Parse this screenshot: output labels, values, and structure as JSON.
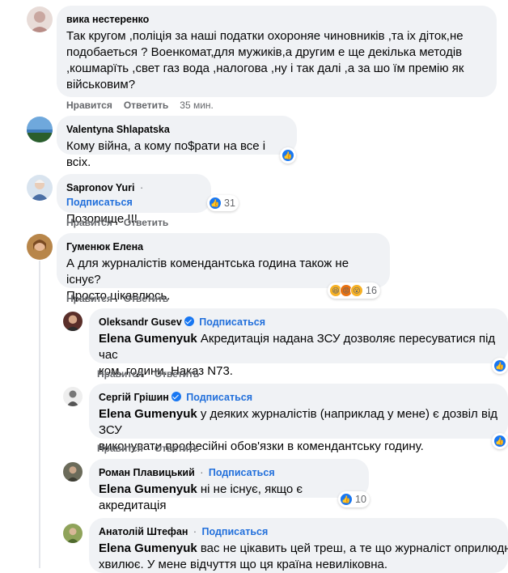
{
  "actions": {
    "like": "Нравится",
    "reply": "Ответить"
  },
  "comments": [
    {
      "name": "вика нестеренко",
      "lines": [
        "Так кругом ,поліція за наші податки охороняе чиновників ,та іх діток,не",
        "подобаеться ? Военкомат,для мужиків,а другим е ще декілька методів",
        ",кошмарїть ,свет газ вода ,налогова ,ну і так далі ,а за шо їм премію як",
        "військовим?"
      ],
      "time": "35 мин."
    },
    {
      "name": "Valentyna Shlapatska",
      "lines": [
        "Кому війна, а кому по$рати на все і всіх."
      ]
    },
    {
      "name": "Sapronov Yuri",
      "dot": "·",
      "subscribe": "Подписаться",
      "lines": [
        "Позорище !!!"
      ],
      "reaction_count": "31"
    },
    {
      "name": "Гуменюк Елена",
      "lines": [
        "А для журналістів комендантська година також не існує?",
        "Просто цікавлюсь."
      ],
      "reaction_count": "16"
    }
  ],
  "replies": [
    {
      "name": "Oleksandr Gusev",
      "subscribe": "Подписаться",
      "mention": "Elena Gumenyuk",
      "first": " Акредитація надана ЗСУ дозволяє пересуватися під час",
      "second": "ком. години. Наказ N73."
    },
    {
      "name": "Сергій Грішин",
      "subscribe": "Подписаться",
      "mention": "Elena Gumenyuk",
      "first": " у деяких журналістів (наприклад у мене) є дозвіл від ЗСУ",
      "second": "виконувати професійні обов'язки в комендантську годину."
    },
    {
      "name": "Роман Плавицький",
      "dot": "·",
      "subscribe": "Подписаться",
      "mention": "Elena Gumenyuk",
      "first": " ні не існує, якщо є акредитація",
      "reaction_count": "10"
    },
    {
      "name": "Анатолій Штефан",
      "dot": "·",
      "subscribe": "Подписаться",
      "mention": "Elena Gumenyuk",
      "first": " вас не цікавить цей треш, а те що журналіст оприлюднив",
      "second": "хвилює. У мене відчуття що ця країна невиліковна."
    }
  ],
  "colors": {
    "bubble": "#f0f2f5",
    "link": "#216fdb",
    "like": "#1877f2",
    "meta": "#65676b"
  }
}
